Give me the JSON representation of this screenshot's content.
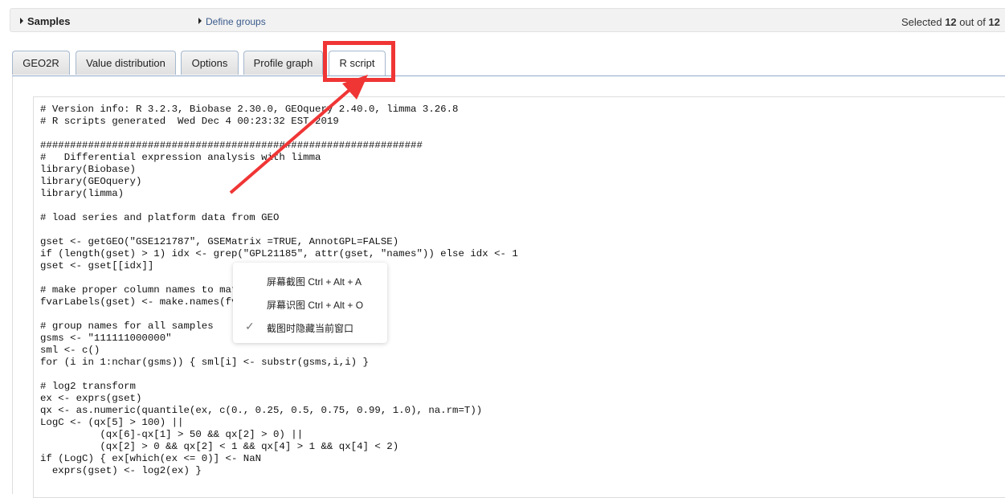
{
  "topbar": {
    "samples": "Samples",
    "define_groups": "Define groups",
    "selected_prefix": "Selected ",
    "selected_count": "12",
    "selected_mid": " out of ",
    "selected_total": "12"
  },
  "tabs": [
    {
      "label": "GEO2R"
    },
    {
      "label": "Value distribution"
    },
    {
      "label": "Options"
    },
    {
      "label": "Profile graph"
    },
    {
      "label": "R script",
      "active": true
    }
  ],
  "script": [
    "# Version info: R 3.2.3, Biobase 2.30.0, GEOquery 2.40.0, limma 3.26.8",
    "# R scripts generated  Wed Dec 4 00:23:32 EST 2019",
    "",
    "################################################################",
    "#   Differential expression analysis with limma",
    "library(Biobase)",
    "library(GEOquery)",
    "library(limma)",
    "",
    "# load series and platform data from GEO",
    "",
    "gset <- getGEO(\"GSE121787\", GSEMatrix =TRUE, AnnotGPL=FALSE)",
    "if (length(gset) > 1) idx <- grep(\"GPL21185\", attr(gset, \"names\")) else idx <- 1",
    "gset <- gset[[idx]]",
    "",
    "# make proper column names to match toptable",
    "fvarLabels(gset) <- make.names(fvarLabels(gset))",
    "",
    "# group names for all samples",
    "gsms <- \"111111000000\"",
    "sml <- c()",
    "for (i in 1:nchar(gsms)) { sml[i] <- substr(gsms,i,i) }",
    "",
    "# log2 transform",
    "ex <- exprs(gset)",
    "qx <- as.numeric(quantile(ex, c(0., 0.25, 0.5, 0.75, 0.99, 1.0), na.rm=T))",
    "LogC <- (qx[5] > 100) ||",
    "          (qx[6]-qx[1] > 50 && qx[2] > 0) ||",
    "          (qx[2] > 0 && qx[2] < 1 && qx[4] > 1 && qx[4] < 2)",
    "if (LogC) { ex[which(ex <= 0)] <- NaN",
    "  exprs(gset) <- log2(ex) }"
  ],
  "context_menu": {
    "items": [
      {
        "label": "屏幕截图 Ctrl + Alt + A"
      },
      {
        "label": "屏幕识图 Ctrl + Alt + O"
      },
      {
        "label": "截图时隐藏当前窗口",
        "checked": true
      }
    ]
  },
  "annotation": {
    "color": "#f03535"
  }
}
